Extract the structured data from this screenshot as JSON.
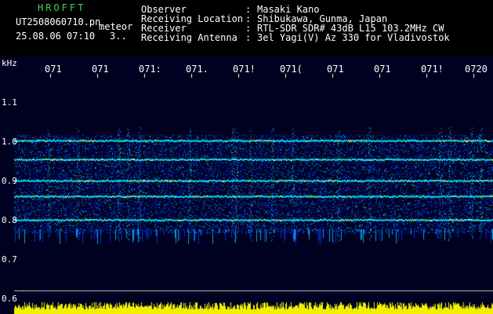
{
  "header": {
    "brand": "HROFFT",
    "filename": "UT2508060710.pn",
    "mode": "meteor",
    "datetime": "25.08.06 07:10",
    "count": "3..",
    "info": [
      {
        "label": "Observer",
        "value": "Masaki Kano"
      },
      {
        "label": "Receiving Location",
        "value": "Shibukawa, Gunma, Japan"
      },
      {
        "label": "Receiver",
        "value": "RTL-SDR SDR# 43dB L15 103.2MHz CW"
      },
      {
        "label": "Receiving Antenna",
        "value": "3el Yagi(V) Az 330 for Vladivostok"
      }
    ]
  },
  "time_axis": [
    "071",
    "071",
    "071:",
    "071.",
    "071!",
    "071(",
    "071",
    "071",
    "071!",
    "0720"
  ],
  "freq_axis": {
    "unit": "kHz",
    "ticks": [
      "1.1",
      "1.0",
      "0.9",
      "0.8",
      "0.7",
      "0.6"
    ]
  },
  "colors": {
    "background": "#000020",
    "trace": "#00e0ff",
    "label_green": "#39d353",
    "level": "#f0f000"
  }
}
